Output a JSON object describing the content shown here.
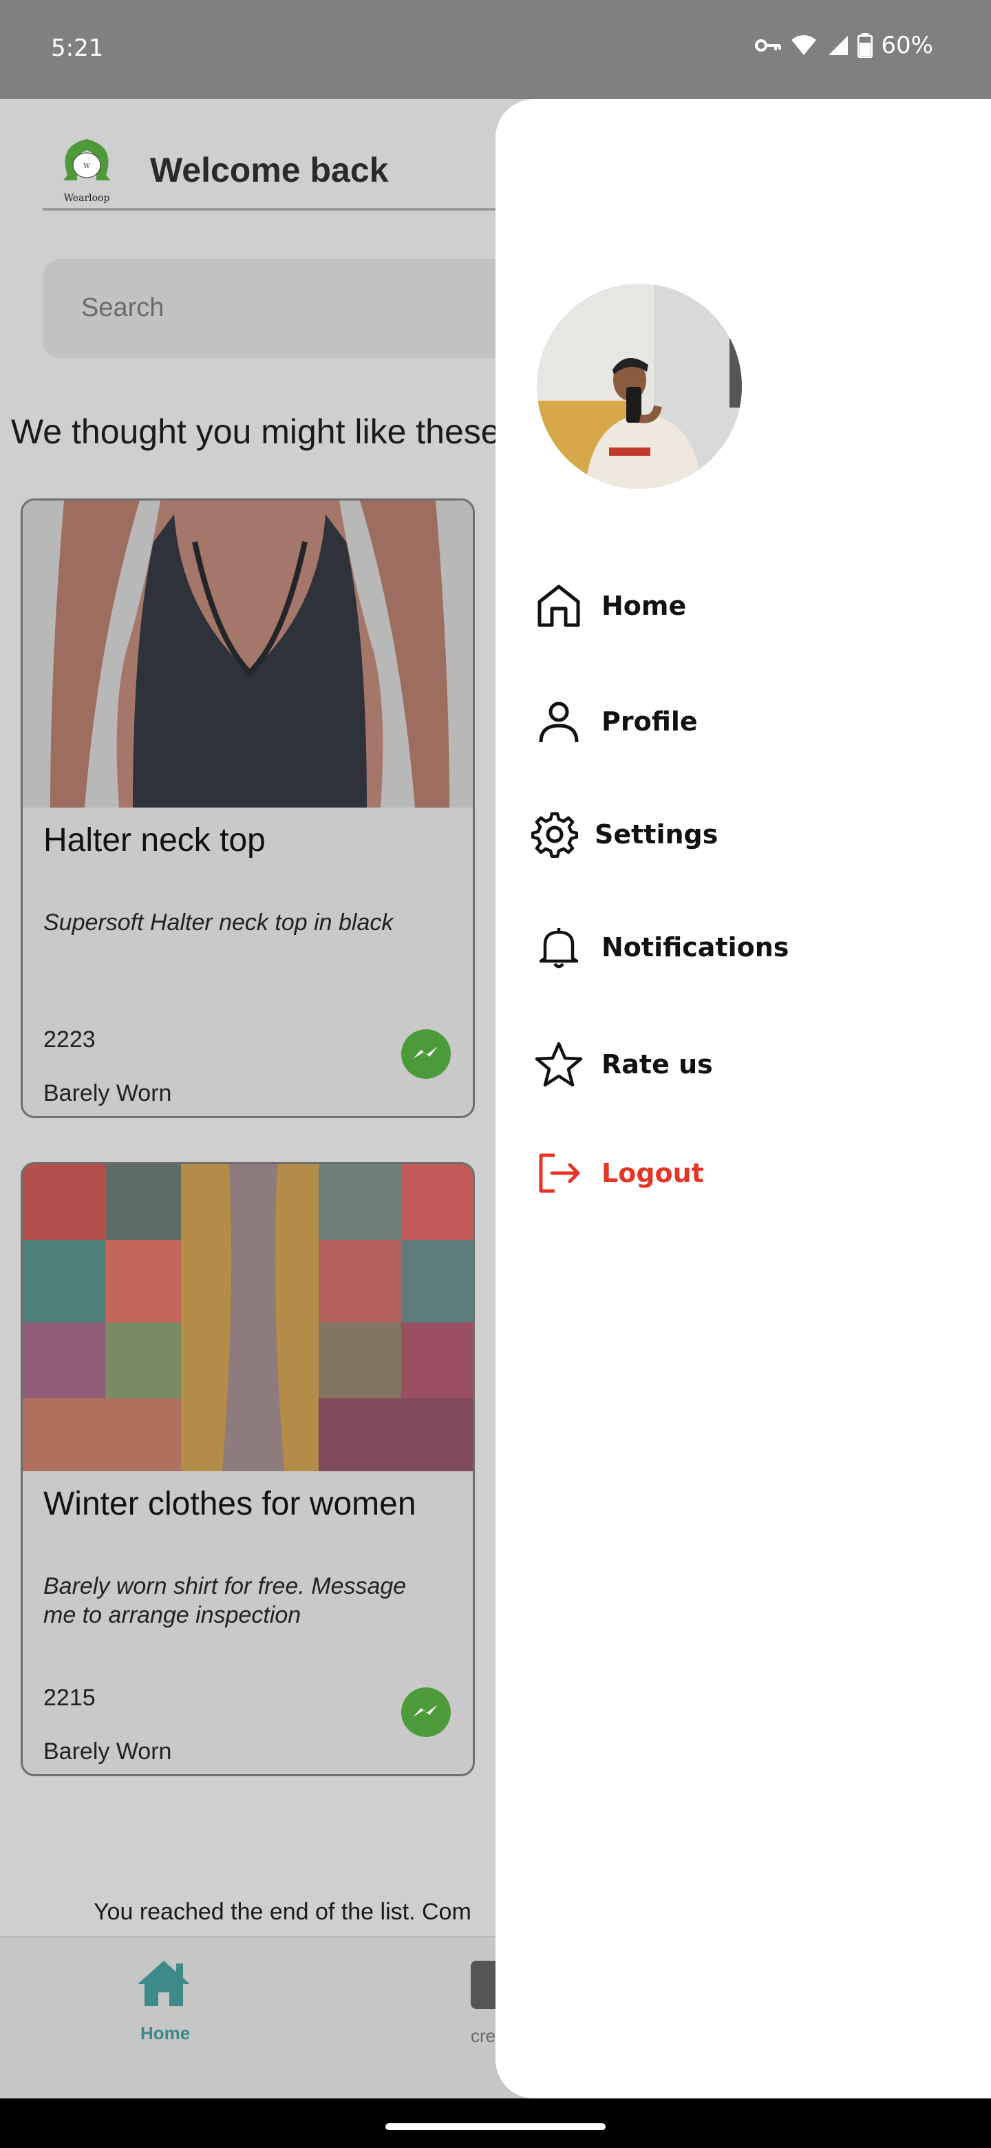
{
  "status_bar": {
    "time": "5:21",
    "battery": "60%"
  },
  "header": {
    "welcome": "Welcome back",
    "logo_text": "Wearloop"
  },
  "search": {
    "placeholder": "Search"
  },
  "section_title": "We thought you might like these",
  "items": [
    {
      "title": "Halter neck top",
      "description": "Supersoft Halter neck top in black",
      "price": "2223",
      "condition": "Barely Worn"
    },
    {
      "title": "Winter clothes for women",
      "description": "Barely worn shirt for free. Message me to arrange inspection",
      "price": "2215",
      "condition": "Barely Worn"
    }
  ],
  "end_text": "You reached the end of the list. Com",
  "bottom_nav": {
    "home": "Home",
    "create": "cre"
  },
  "drawer": {
    "menu": [
      {
        "label": "Home",
        "icon": "home-icon"
      },
      {
        "label": "Profile",
        "icon": "person-icon"
      },
      {
        "label": "Settings",
        "icon": "gear-icon"
      },
      {
        "label": "Notifications",
        "icon": "bell-icon"
      },
      {
        "label": "Rate us",
        "icon": "star-icon"
      },
      {
        "label": "Logout",
        "icon": "logout-icon"
      }
    ]
  },
  "colors": {
    "accent": "#3e8a8a",
    "logout": "#e53525",
    "messenger": "#4d9a3a"
  }
}
